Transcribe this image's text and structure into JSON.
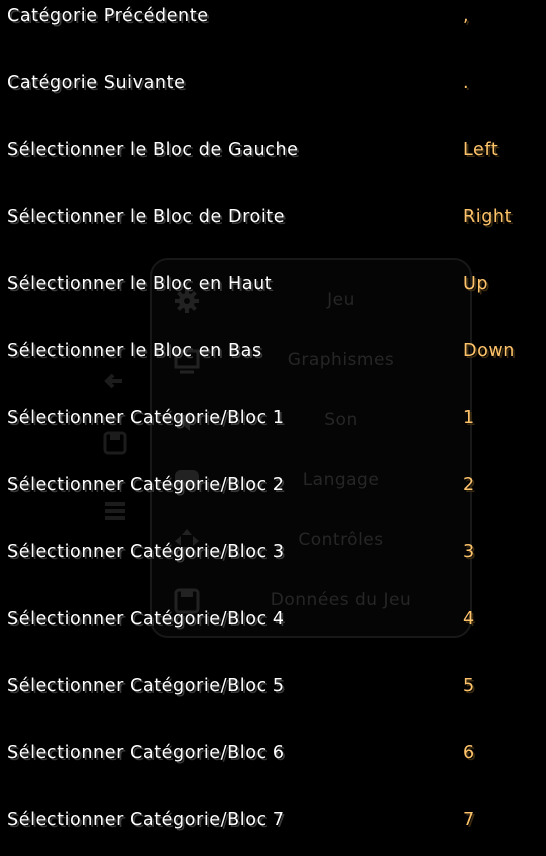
{
  "settings_menu": {
    "items": [
      {
        "icon": "gear-icon",
        "label": "Jeu"
      },
      {
        "icon": "monitor-icon",
        "label": "Graphismes"
      },
      {
        "icon": "speaker-icon",
        "label": "Son"
      },
      {
        "icon": "speech-bubble-icon",
        "label": "Langage"
      },
      {
        "icon": "arrows-move-icon",
        "label": "Contrôles"
      },
      {
        "icon": "floppy-disk-icon",
        "label": "Données du Jeu"
      }
    ]
  },
  "keybindings": [
    {
      "action": "Catégorie Précédente",
      "key": ","
    },
    {
      "action": "Catégorie Suivante",
      "key": "."
    },
    {
      "action": "Sélectionner le Bloc de Gauche",
      "key": "Left"
    },
    {
      "action": "Sélectionner le Bloc de Droite",
      "key": "Right"
    },
    {
      "action": "Sélectionner le Bloc en Haut",
      "key": "Up"
    },
    {
      "action": "Sélectionner le Bloc en Bas",
      "key": "Down"
    },
    {
      "action": "Sélectionner Catégorie/Bloc 1",
      "key": "1"
    },
    {
      "action": "Sélectionner Catégorie/Bloc 2",
      "key": "2"
    },
    {
      "action": "Sélectionner Catégorie/Bloc 3",
      "key": "3"
    },
    {
      "action": "Sélectionner Catégorie/Bloc 4",
      "key": "4"
    },
    {
      "action": "Sélectionner Catégorie/Bloc 5",
      "key": "5"
    },
    {
      "action": "Sélectionner Catégorie/Bloc 6",
      "key": "6"
    },
    {
      "action": "Sélectionner Catégorie/Bloc 7",
      "key": "7"
    }
  ],
  "colors": {
    "background": "#000000",
    "action_text": "#ffffff",
    "key_text": "#ffc46b",
    "faded_menu_text": "#262626"
  }
}
